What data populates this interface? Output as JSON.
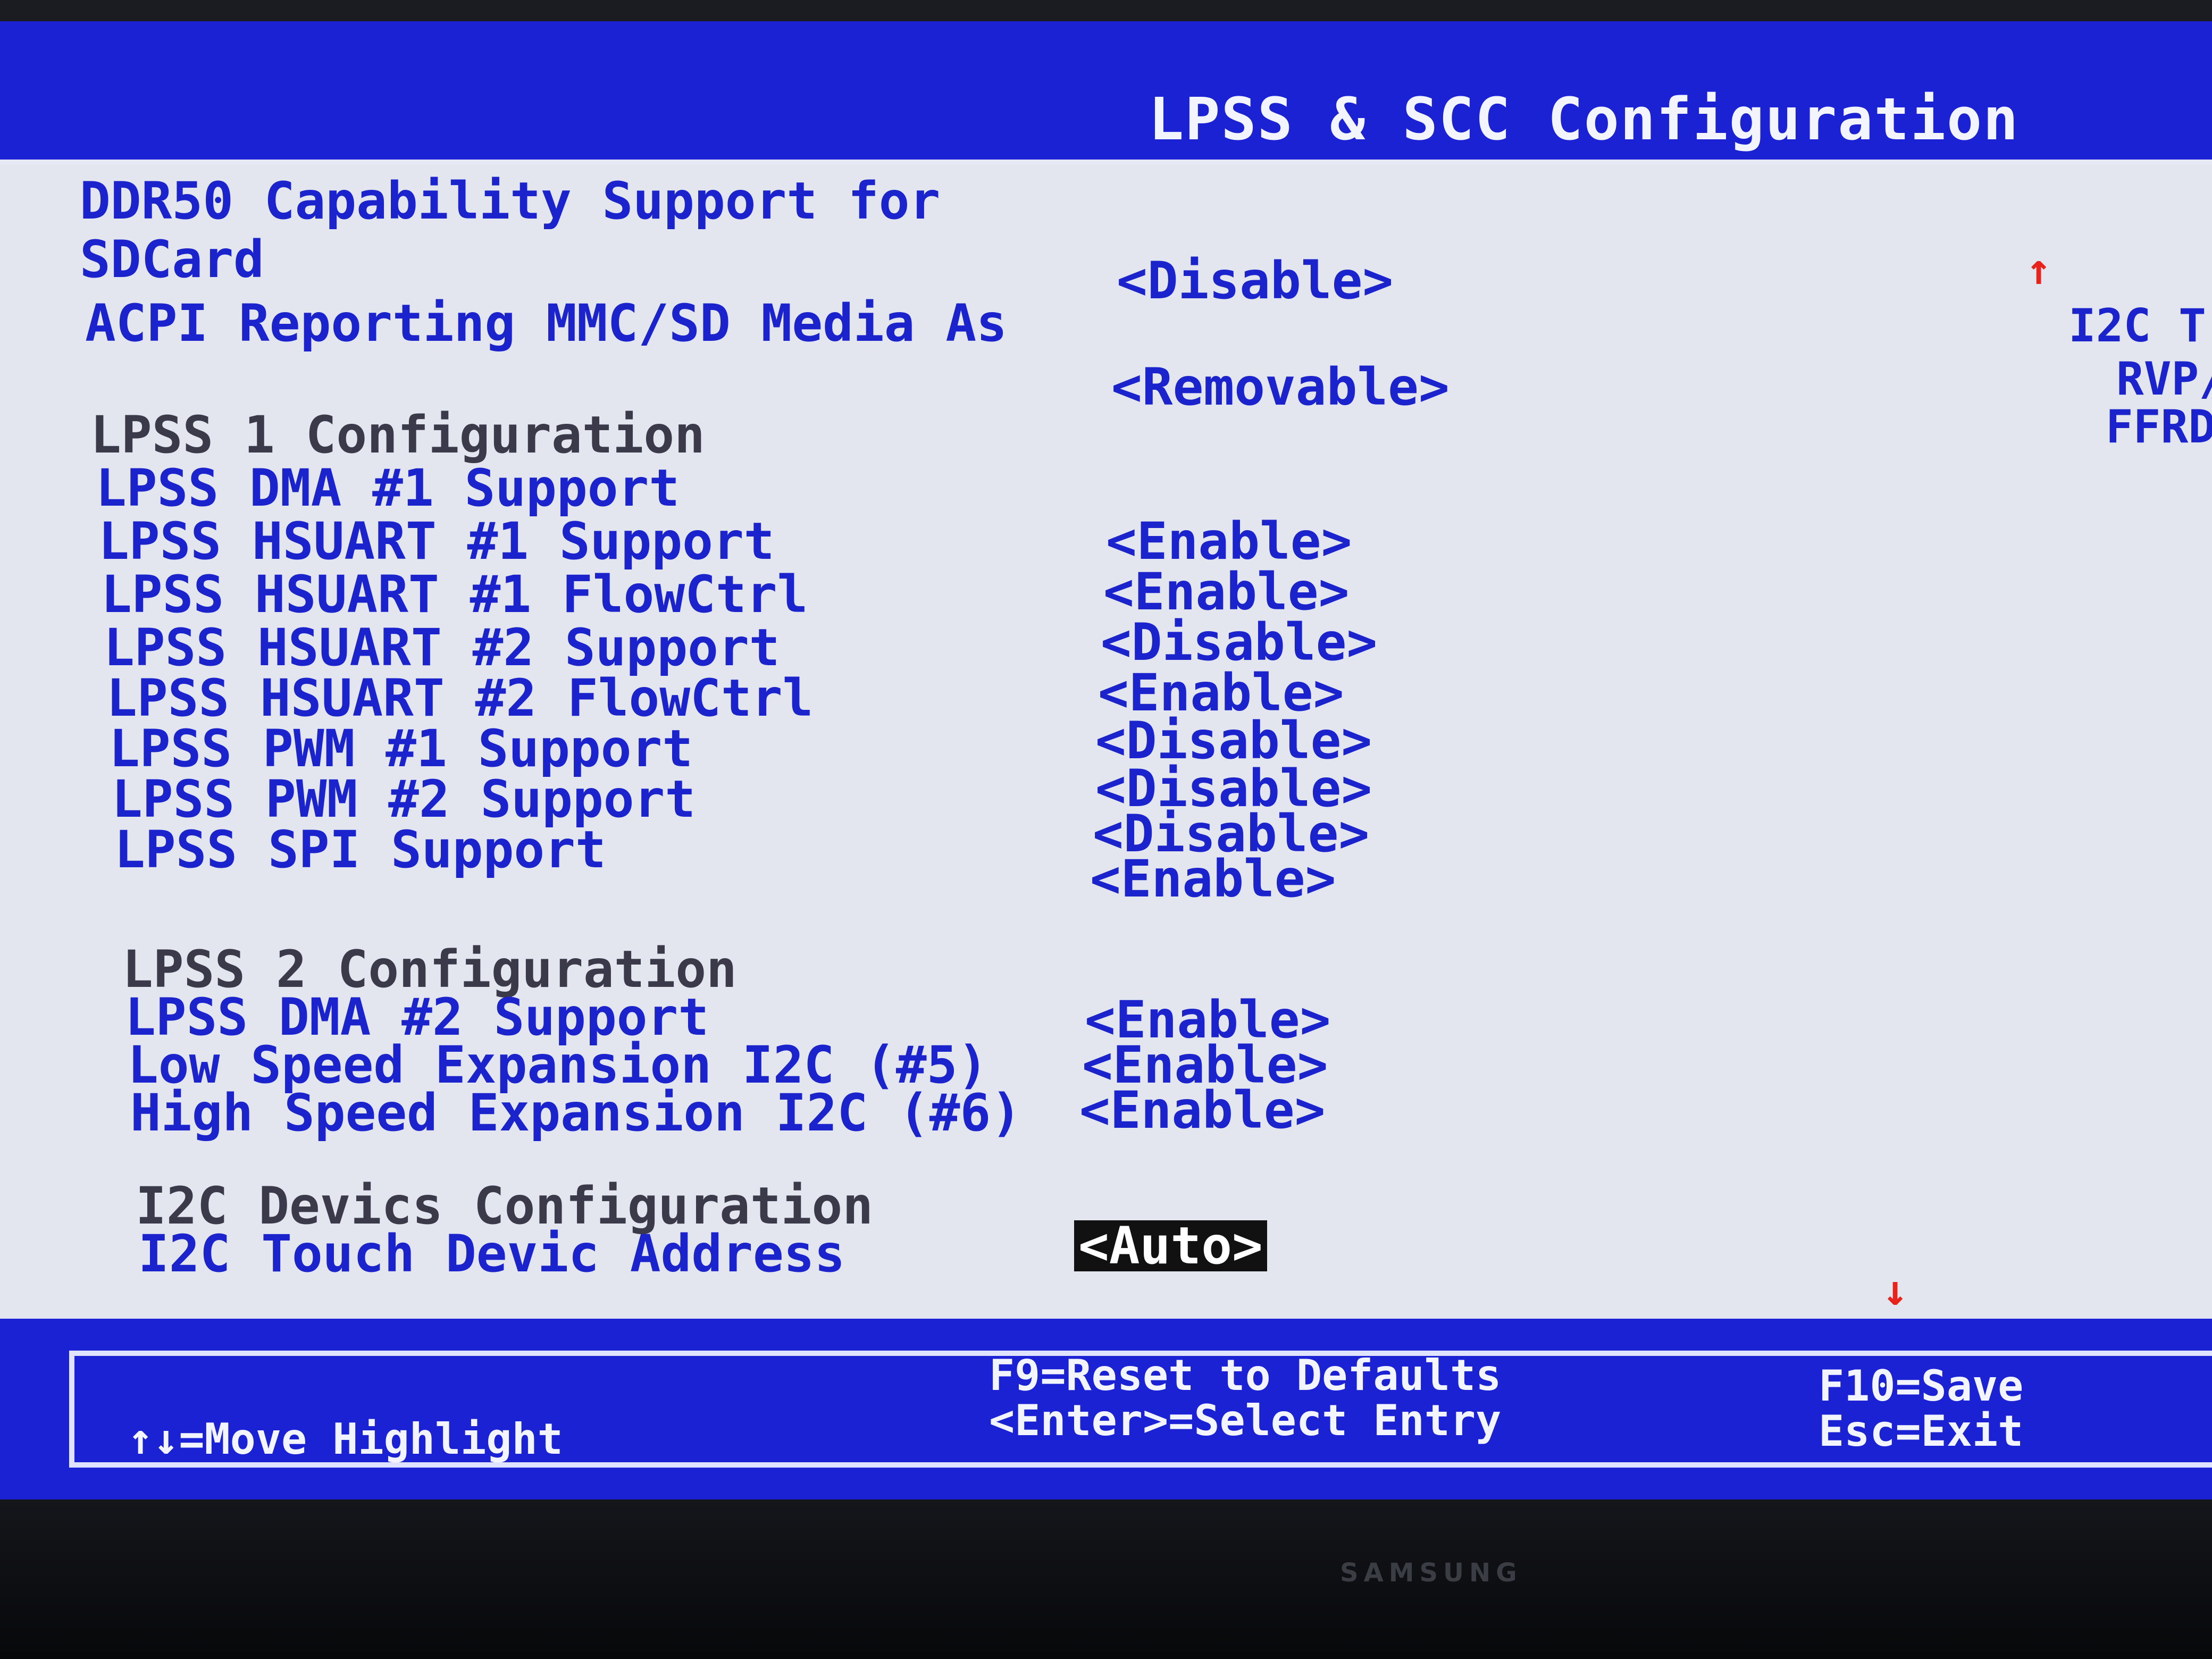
{
  "header": {
    "title": "LPSS & SCC Configuration"
  },
  "settings": {
    "ddr50_label_line1": "DDR50 Capability Support for",
    "ddr50_label_line2": "SDCard",
    "ddr50_value": "<Disable>",
    "acpi_label": "ACPI Reporting MMC/SD Media As",
    "acpi_value": "<Removable>",
    "lpss1_header": "LPSS 1 Configuration",
    "lpss1_items": [
      {
        "label": "LPSS DMA #1 Support",
        "value": ""
      },
      {
        "label": "LPSS HSUART #1 Support",
        "value": "<Enable>"
      },
      {
        "label": "LPSS HSUART #1 FlowCtrl",
        "value": "<Enable>"
      },
      {
        "label": "LPSS HSUART #2 Support",
        "value": "<Disable>"
      },
      {
        "label": "LPSS HSUART #2 FlowCtrl",
        "value": "<Enable>"
      },
      {
        "label": "LPSS PWM #1 Support",
        "value": "<Disable>"
      },
      {
        "label": "LPSS PWM #2 Support",
        "value": "<Disable>"
      },
      {
        "label": "LPSS SPI Support",
        "value": "<Disable>"
      },
      {
        "label": "",
        "value": "<Enable>"
      }
    ],
    "lpss2_header": "LPSS 2 Configuration",
    "lpss2_items": [
      {
        "label": "LPSS DMA #2 Support",
        "value": "<Enable>"
      },
      {
        "label": "Low Speed Expansion I2C (#5)",
        "value": "<Enable>"
      },
      {
        "label": "High Speed Expansion I2C (#6)",
        "value": "<Enable>"
      }
    ],
    "i2c_header": "I2C Devics Configuration",
    "i2c_touch_label": "I2C Touch Devic Address",
    "i2c_touch_value": "<Auto>"
  },
  "help_panel": {
    "line1": "I2C T",
    "line2": "RVP/",
    "line3": "FFRD"
  },
  "footer": {
    "move": "↑↓=Move Highlight",
    "reset": "F9=Reset to Defaults",
    "select": "<Enter>=Select Entry",
    "save": "F10=Save",
    "exit": "Esc=Exit"
  },
  "monitor": {
    "brand": "SAMSUNG"
  },
  "colors": {
    "title_bar": "#1a22d4",
    "content_bg": "#e3e5ef",
    "setting_text": "#1b24cc",
    "highlight": "#111111",
    "scroll_arrow": "#e8231b"
  }
}
